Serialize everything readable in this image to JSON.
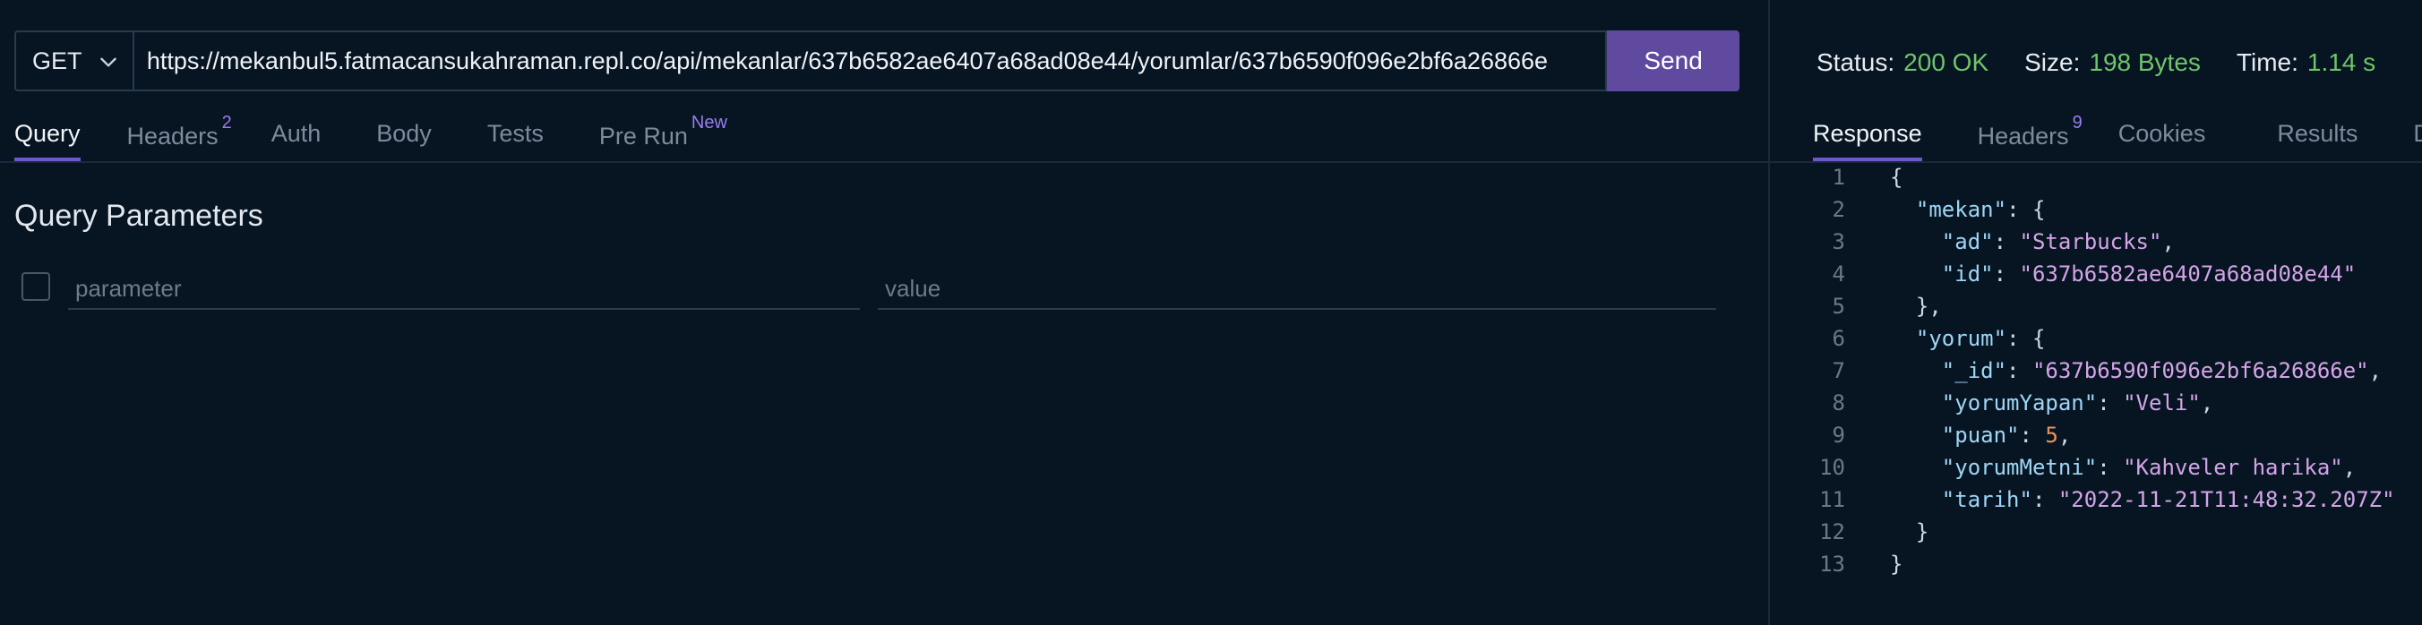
{
  "request": {
    "method": "GET",
    "url": "https://mekanbul5.fatmacansukahraman.repl.co/api/mekanlar/637b6582ae6407a68ad08e44/yorumlar/637b6590f096e2bf6a26866e",
    "send_label": "Send"
  },
  "request_tabs": [
    {
      "label": "Query",
      "badge": ""
    },
    {
      "label": "Headers",
      "badge": "2"
    },
    {
      "label": "Auth",
      "badge": ""
    },
    {
      "label": "Body",
      "badge": ""
    },
    {
      "label": "Tests",
      "badge": ""
    },
    {
      "label": "Pre Run",
      "badge": "New"
    }
  ],
  "query": {
    "title": "Query Parameters",
    "param_placeholder": "parameter",
    "value_placeholder": "value"
  },
  "response": {
    "status_label": "Status:",
    "status_value": "200 OK",
    "size_label": "Size:",
    "size_value": "198 Bytes",
    "time_label": "Time:",
    "time_value": "1.14 s",
    "tabs": [
      {
        "label": "Response",
        "badge": ""
      },
      {
        "label": "Headers",
        "badge": "9"
      },
      {
        "label": "Cookies",
        "badge": ""
      },
      {
        "label": "Results",
        "badge": ""
      },
      {
        "label": "D",
        "badge": ""
      }
    ],
    "line_numbers": [
      "1",
      "2",
      "3",
      "4",
      "5",
      "6",
      "7",
      "8",
      "9",
      "10",
      "11",
      "12",
      "13"
    ],
    "body": {
      "mekan_key": "\"mekan\"",
      "ad_key": "\"ad\"",
      "ad_value": "\"Starbucks\"",
      "id_key": "\"id\"",
      "id_value": "\"637b6582ae6407a68ad08e44\"",
      "yorum_key": "\"yorum\"",
      "_id_key": "\"_id\"",
      "_id_value": "\"637b6590f096e2bf6a26866e\"",
      "yorumYapan_key": "\"yorumYapan\"",
      "yorumYapan_value": "\"Veli\"",
      "puan_key": "\"puan\"",
      "puan_value": "5",
      "yorumMetni_key": "\"yorumMetni\"",
      "yorumMetni_value": "\"Kahveler harika\"",
      "tarih_key": "\"tarih\"",
      "tarih_value": "\"2022-11-21T11:48:32.207Z\""
    }
  },
  "colors": {
    "background": "#071523",
    "accent": "#5f4aa0",
    "status_ok": "#6fc56a",
    "json_key": "#9fd5f5",
    "json_string": "#d4a4e6",
    "json_number": "#f0915a"
  }
}
